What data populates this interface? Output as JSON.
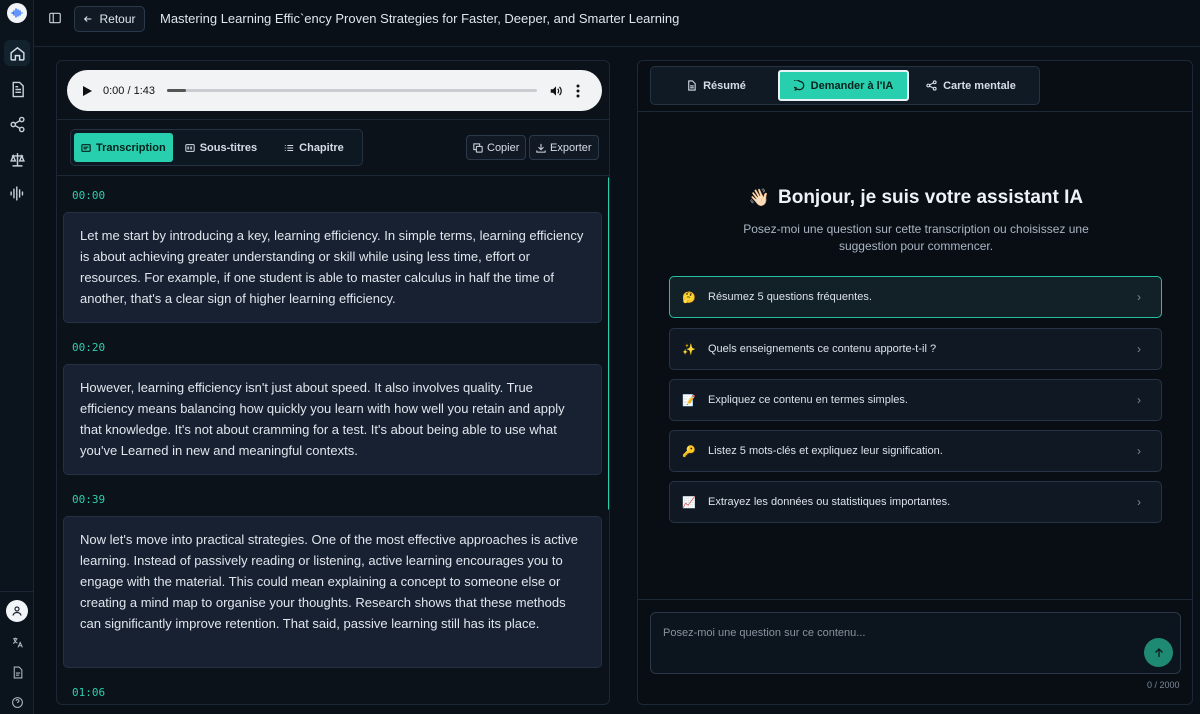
{
  "header": {
    "back_label": "Retour",
    "title": "Mastering Learning Effic`ency Proven Strategies for Faster, Deeper, and Smarter Learning"
  },
  "rail": {
    "icons": [
      "home-icon",
      "document-icon",
      "share-icon",
      "scale-icon",
      "waveform-icon"
    ],
    "bottom_icons": [
      "user-icon",
      "translate-icon",
      "file-icon",
      "help-icon"
    ]
  },
  "audio": {
    "time": "0:00 / 1:43",
    "progress": 0.05
  },
  "left_tabs": [
    {
      "label": "Transcription",
      "icon": "text-icon",
      "active": true
    },
    {
      "label": "Sous-titres",
      "icon": "cc-icon",
      "active": false
    },
    {
      "label": "Chapitre",
      "icon": "list-icon",
      "active": false
    }
  ],
  "tools": {
    "copy_label": "Copier",
    "export_label": "Exporter"
  },
  "segments": [
    {
      "time": "00:00",
      "text": "Let me start by introducing a key, learning efficiency. In simple terms, learning efficiency is about achieving greater understanding or skill while using less time, effort or resources. For example, if one student is able to master calculus in half the time of another, that's a clear sign of higher learning efficiency."
    },
    {
      "time": "00:20",
      "text": "However, learning efficiency isn't just about speed. It also involves quality. True efficiency means balancing how quickly you learn with how well you retain and apply that knowledge. It's not about cramming for a test. It's about being able to use what you've Learned in new and meaningful contexts."
    },
    {
      "time": "00:39",
      "text": "Now let's move into practical strategies. One of the most effective approaches is active learning. Instead of passively reading or listening, active learning encourages you to engage with the material. This could mean explaining a concept to someone else or creating a mind map to organise your thoughts. Research shows that these methods can significantly improve retention. That said, passive learning still has its place."
    },
    {
      "time": "01:06",
      "text": ""
    }
  ],
  "right_tabs": [
    {
      "label": "Résumé",
      "icon": "doc-icon",
      "active": false
    },
    {
      "label": "Demander à l'IA",
      "icon": "chat-icon",
      "active": true
    },
    {
      "label": "Carte mentale",
      "icon": "share-icon",
      "active": false
    }
  ],
  "assistant": {
    "emoji": "👋🏻",
    "greeting": "Bonjour, je suis votre assistant IA",
    "subtitle": "Posez-moi une question sur cette transcription ou choisissez une suggestion pour commencer."
  },
  "suggestions": [
    {
      "emoji": "🤔",
      "label": "Résumez 5 questions fréquentes."
    },
    {
      "emoji": "✨",
      "label": "Quels enseignements ce contenu apporte-t-il ?"
    },
    {
      "emoji": "📝",
      "label": "Expliquez ce contenu en termes simples."
    },
    {
      "emoji": "🔑",
      "label": "Listez 5 mots-clés et expliquez leur signification."
    },
    {
      "emoji": "📈",
      "label": "Extrayez les données ou statistiques importantes."
    }
  ],
  "chat_input": {
    "placeholder": "Posez-moi une question sur ce contenu...",
    "counter": "0 / 2000"
  },
  "colors": {
    "accent": "#27cfae",
    "background": "#0a1017",
    "segment_bg": "#172132"
  }
}
